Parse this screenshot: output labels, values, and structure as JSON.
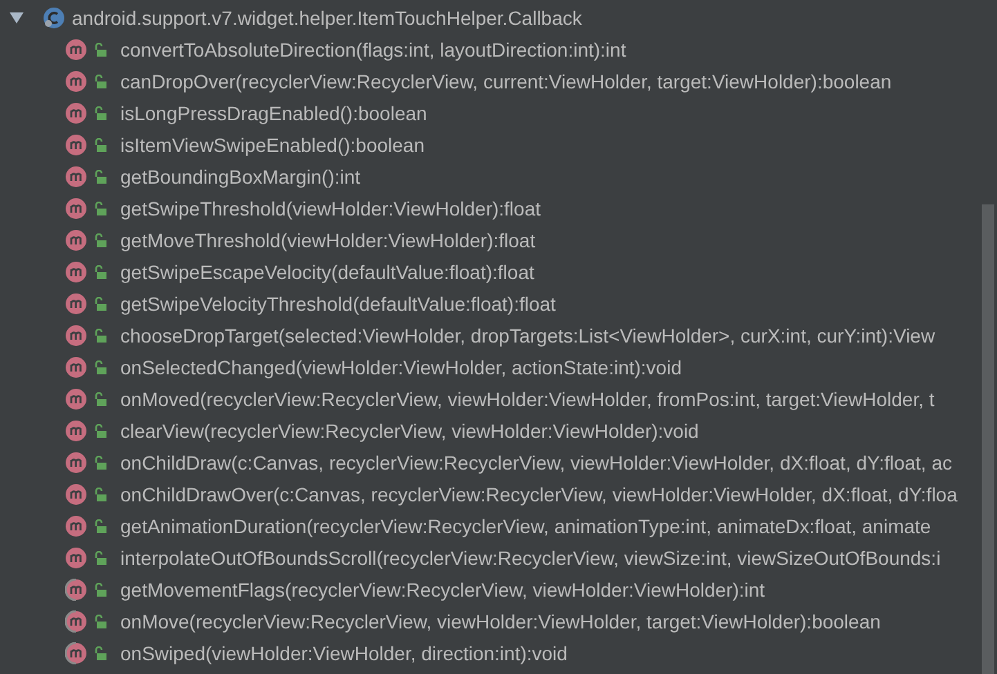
{
  "class_node": {
    "title": "android.support.v7.widget.helper.ItemTouchHelper.Callback",
    "expanded": true
  },
  "members": [
    {
      "kind": "method",
      "text": "convertToAbsoluteDirection(flags:int, layoutDirection:int):int"
    },
    {
      "kind": "method",
      "text": "canDropOver(recyclerView:RecyclerView, current:ViewHolder, target:ViewHolder):boolean"
    },
    {
      "kind": "method",
      "text": "isLongPressDragEnabled():boolean"
    },
    {
      "kind": "method",
      "text": "isItemViewSwipeEnabled():boolean"
    },
    {
      "kind": "method",
      "text": "getBoundingBoxMargin():int"
    },
    {
      "kind": "method",
      "text": "getSwipeThreshold(viewHolder:ViewHolder):float"
    },
    {
      "kind": "method",
      "text": "getMoveThreshold(viewHolder:ViewHolder):float"
    },
    {
      "kind": "method",
      "text": "getSwipeEscapeVelocity(defaultValue:float):float"
    },
    {
      "kind": "method",
      "text": "getSwipeVelocityThreshold(defaultValue:float):float"
    },
    {
      "kind": "method",
      "text": "chooseDropTarget(selected:ViewHolder, dropTargets:List<ViewHolder>, curX:int, curY:int):View"
    },
    {
      "kind": "method",
      "text": "onSelectedChanged(viewHolder:ViewHolder, actionState:int):void"
    },
    {
      "kind": "method",
      "text": "onMoved(recyclerView:RecyclerView, viewHolder:ViewHolder, fromPos:int, target:ViewHolder, t"
    },
    {
      "kind": "method",
      "text": "clearView(recyclerView:RecyclerView, viewHolder:ViewHolder):void"
    },
    {
      "kind": "method",
      "text": "onChildDraw(c:Canvas, recyclerView:RecyclerView, viewHolder:ViewHolder, dX:float, dY:float, ac"
    },
    {
      "kind": "method",
      "text": "onChildDrawOver(c:Canvas, recyclerView:RecyclerView, viewHolder:ViewHolder, dX:float, dY:floa"
    },
    {
      "kind": "method",
      "text": "getAnimationDuration(recyclerView:RecyclerView, animationType:int, animateDx:float, animate"
    },
    {
      "kind": "method",
      "text": "interpolateOutOfBoundsScroll(recyclerView:RecyclerView, viewSize:int, viewSizeOutOfBounds:i"
    },
    {
      "kind": "abstract",
      "text": "getMovementFlags(recyclerView:RecyclerView, viewHolder:ViewHolder):int"
    },
    {
      "kind": "abstract",
      "text": "onMove(recyclerView:RecyclerView, viewHolder:ViewHolder, target:ViewHolder):boolean"
    },
    {
      "kind": "abstract",
      "text": "onSwiped(viewHolder:ViewHolder, direction:int):void"
    }
  ]
}
